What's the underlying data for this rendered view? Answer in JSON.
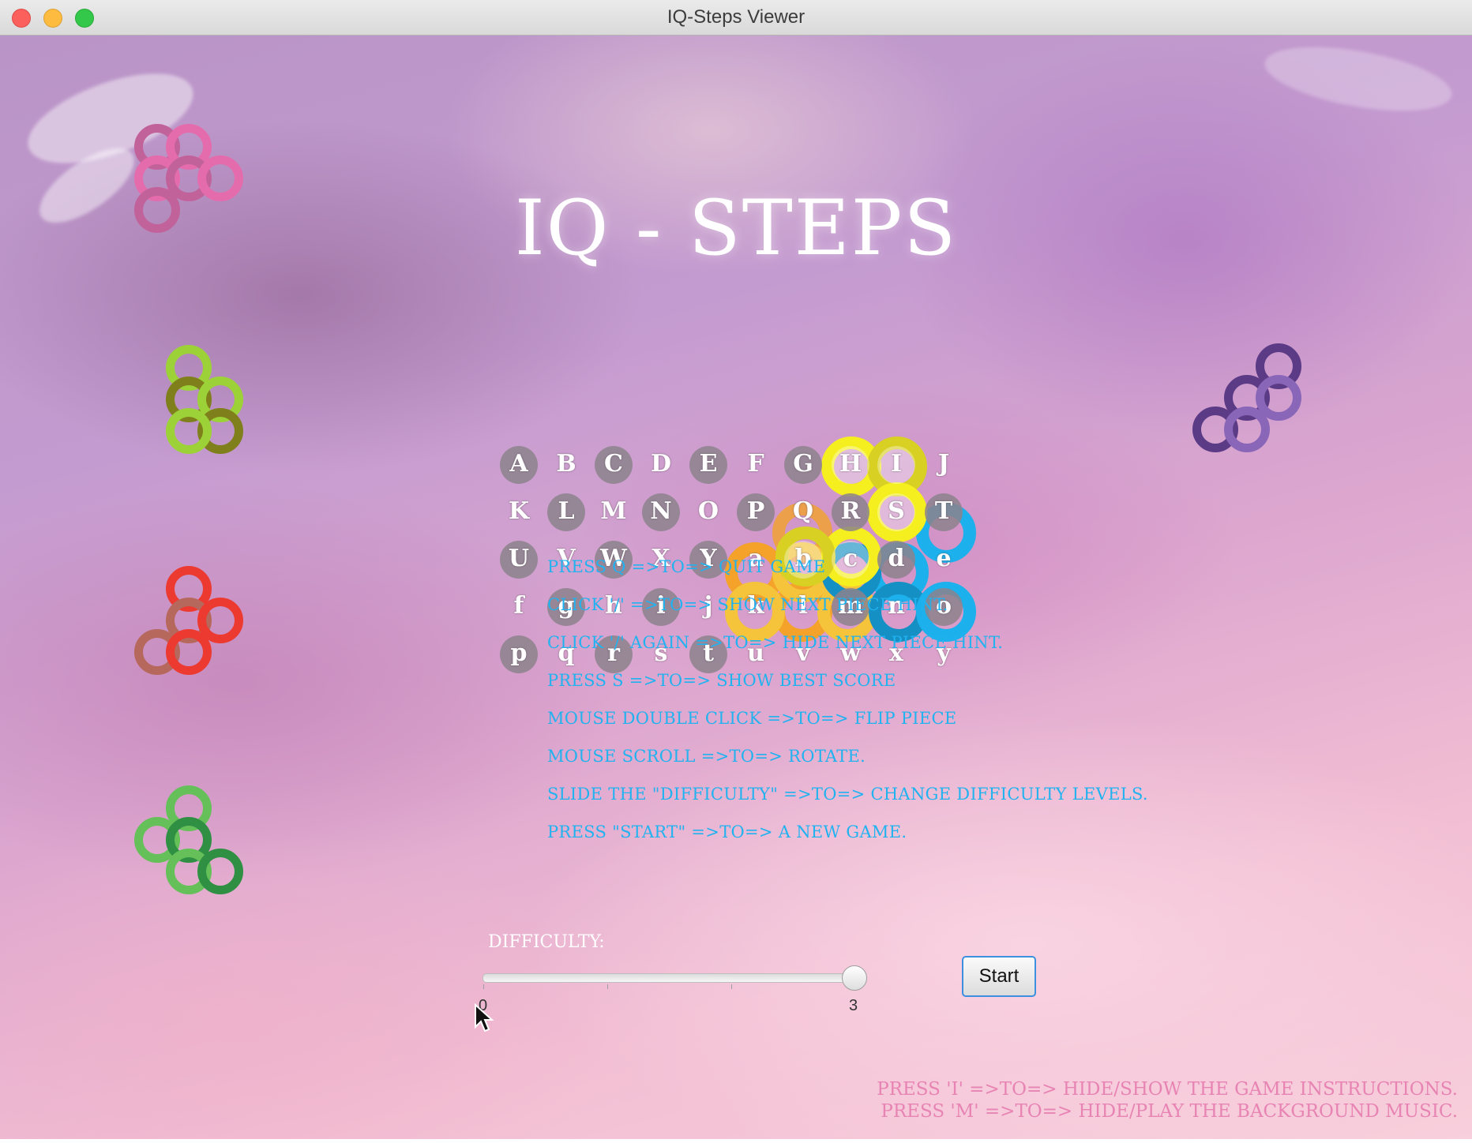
{
  "window": {
    "title": "IQ-Steps Viewer"
  },
  "game": {
    "title": "IQ - STEPS"
  },
  "board": {
    "rows": [
      [
        "A",
        "B",
        "C",
        "D",
        "E",
        "F",
        "G",
        "H",
        "I",
        "J"
      ],
      [
        "K",
        "L",
        "M",
        "N",
        "O",
        "P",
        "Q",
        "R",
        "S",
        "T"
      ],
      [
        "U",
        "V",
        "W",
        "X",
        "Y",
        "a",
        "b",
        "c",
        "d",
        "e"
      ],
      [
        "f",
        "g",
        "h",
        "i",
        "j",
        "k",
        "l",
        "m",
        "n",
        "o"
      ],
      [
        "p",
        "q",
        "r",
        "s",
        "t",
        "u",
        "v",
        "w",
        "x",
        "y"
      ]
    ]
  },
  "colors": {
    "pink": "#e46cac",
    "pink_dark": "#c2629a",
    "lime": "#9cd238",
    "olive": "#7f7f1b",
    "red": "#ec3a30",
    "red_dark": "#b7685c",
    "green": "#66c05a",
    "green_dark": "#2f8f43",
    "purple": "#5b3a86",
    "purple_light": "#8a66b8",
    "yellow": "#f5ef1f",
    "yellow_dark": "#d8d022",
    "blue": "#1cb0ec",
    "blue_dark": "#1490c4",
    "orange": "#f4a22a",
    "gold": "#f5c43a",
    "instruction_text": "#21b2f0",
    "hint_text": "#e784b3"
  },
  "instructions": [
    "PRESS Q =>TO=> QUIT GAME",
    "CLICK '/' =>TO=> SHOW NEXT PIECE HINT.",
    "CLICK '/' AGAIN =>TO=> HIDE NEXT PIECE HINT.",
    "PRESS S =>TO=> SHOW BEST SCORE",
    "MOUSE DOUBLE CLICK =>TO=> FLIP PIECE",
    "MOUSE SCROLL =>TO=> ROTATE.",
    "SLIDE THE \"DIFFICULTY\" =>TO=> CHANGE DIFFICULTY LEVELS.",
    "PRESS \"START\" =>TO=> A NEW GAME."
  ],
  "difficulty": {
    "label": "DIFFICULTY:",
    "min": "0",
    "max": "3",
    "value": 3
  },
  "start_button": {
    "label": "Start"
  },
  "bottom_hints": [
    "PRESS 'I' =>TO=> HIDE/SHOW THE GAME INSTRUCTIONS.",
    "PRESS 'M' =>TO=> HIDE/PLAY THE BACKGROUND MUSIC."
  ]
}
